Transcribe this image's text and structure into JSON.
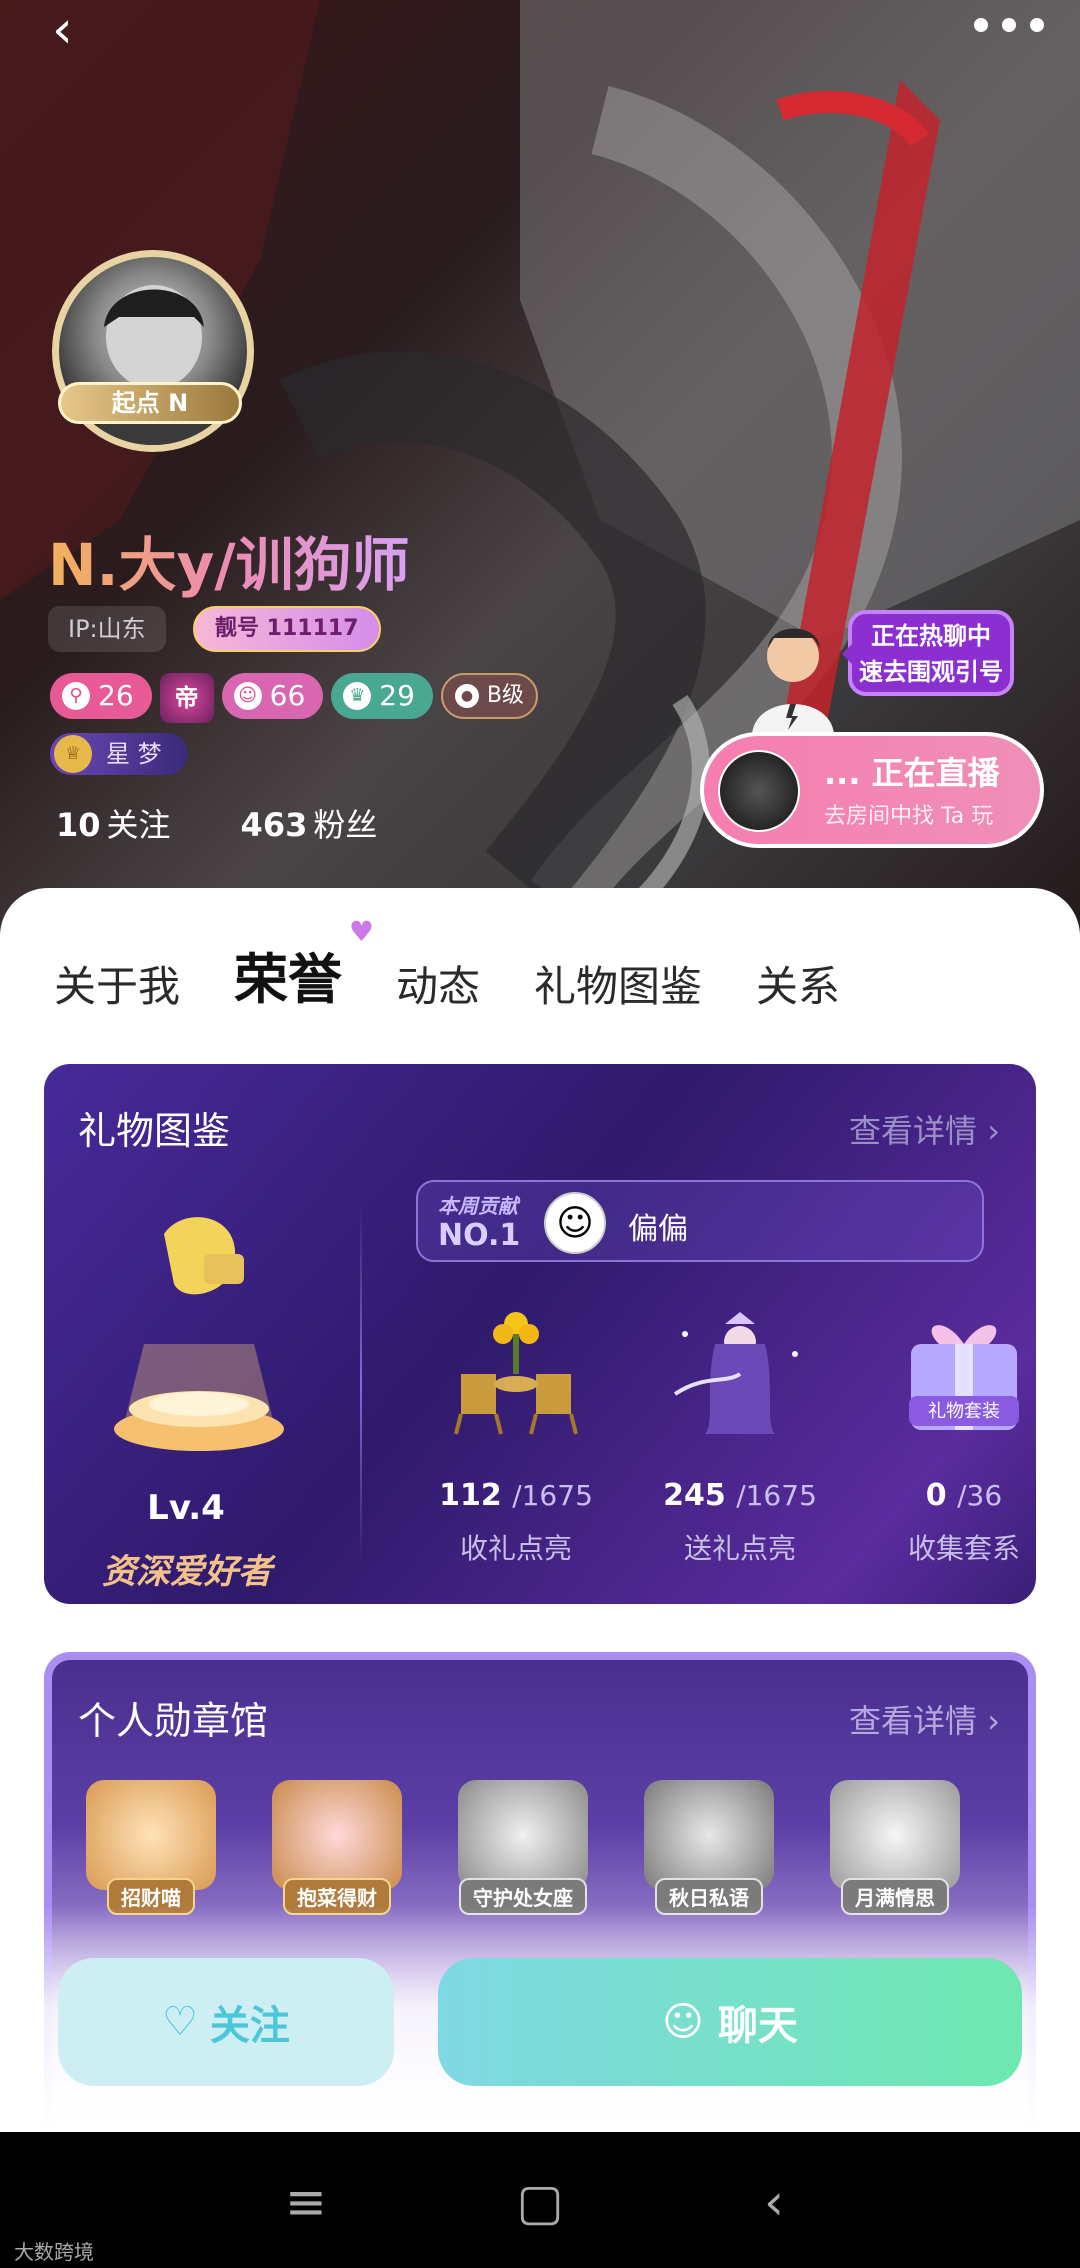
{
  "nav": {
    "back_icon": "chevron-left-icon",
    "more_icon": "more-dots-icon"
  },
  "profile": {
    "avatar_badge": "起点 N",
    "name": "N.大y/训狗师",
    "ip": "IP:山东",
    "nice_id": "靓号 111117",
    "badges": [
      {
        "icon": "key-icon",
        "value": "26"
      },
      {
        "label": "帝"
      },
      {
        "icon": "face-icon",
        "value": "66"
      },
      {
        "icon": "trophy-icon",
        "value": "29"
      },
      {
        "label": "B级"
      }
    ],
    "star_badge": "星 梦",
    "following": {
      "count": "10",
      "label": "关注"
    },
    "followers": {
      "count": "463",
      "label": "粉丝"
    }
  },
  "guide": {
    "bubble_line1": "正在热聊中",
    "bubble_line2": "速去围观引号"
  },
  "live": {
    "title": "... 正在直播",
    "subtitle": "去房间中找 Ta 玩"
  },
  "tabs": [
    {
      "label": "关于我",
      "active": false
    },
    {
      "label": "荣誉",
      "active": true
    },
    {
      "label": "动态",
      "active": false
    },
    {
      "label": "礼物图鉴",
      "active": false
    },
    {
      "label": "关系",
      "active": false
    }
  ],
  "gift_book": {
    "title": "礼物图鉴",
    "link": "查看详情 ›",
    "level": "Lv.4",
    "level_name": "资深爱好者",
    "contrib": {
      "label": "本周贡献",
      "rank": "NO.1",
      "name": "偏偏"
    },
    "stats": [
      {
        "num": "112",
        "total": "/1675",
        "label": "收礼点亮"
      },
      {
        "num": "245",
        "total": "/1675",
        "label": "送礼点亮"
      },
      {
        "num": "0",
        "total": "/36",
        "label": "收集套系",
        "badge": "礼物套装"
      }
    ]
  },
  "medals": {
    "title": "个人勋章馆",
    "link": "查看详情 ›",
    "items": [
      {
        "label": "招财喵",
        "gray": false
      },
      {
        "label": "抱菜得财",
        "gray": false
      },
      {
        "label": "守护处女座",
        "gray": true
      },
      {
        "label": "秋日私语",
        "gray": true
      },
      {
        "label": "月满情思",
        "gray": true
      }
    ]
  },
  "actions": {
    "follow": "关注",
    "chat": "聊天"
  },
  "watermark": "大数跨境",
  "colors": {
    "accent_pink": "#e85a96",
    "chat_gradient_start": "#7fd8e3",
    "chat_gradient_end": "#6ee8b0",
    "card_purple": "#472a9a"
  }
}
